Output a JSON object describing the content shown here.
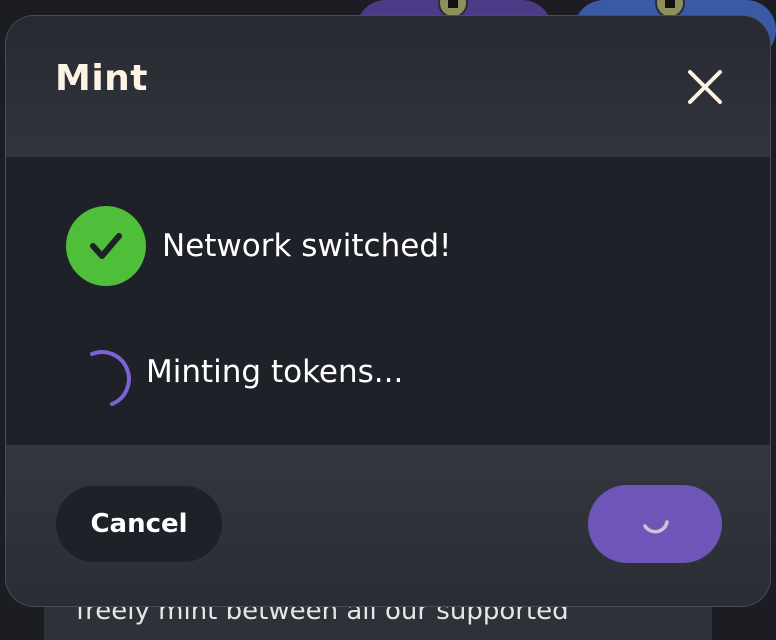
{
  "modal": {
    "title": "Mint",
    "steps": [
      {
        "label": "Network switched!",
        "status": "complete",
        "icon": "check-icon"
      },
      {
        "label": "Minting tokens...",
        "status": "in-progress",
        "icon": "spinner-icon"
      }
    ],
    "cancel_label": "Cancel",
    "submit_state": "loading"
  },
  "background": {
    "text": "freely mint between all our supported"
  },
  "colors": {
    "success": "#4fbf3a",
    "accent": "#6e56b8",
    "spinner": "#7b63d6",
    "title": "#fdf3e4"
  }
}
